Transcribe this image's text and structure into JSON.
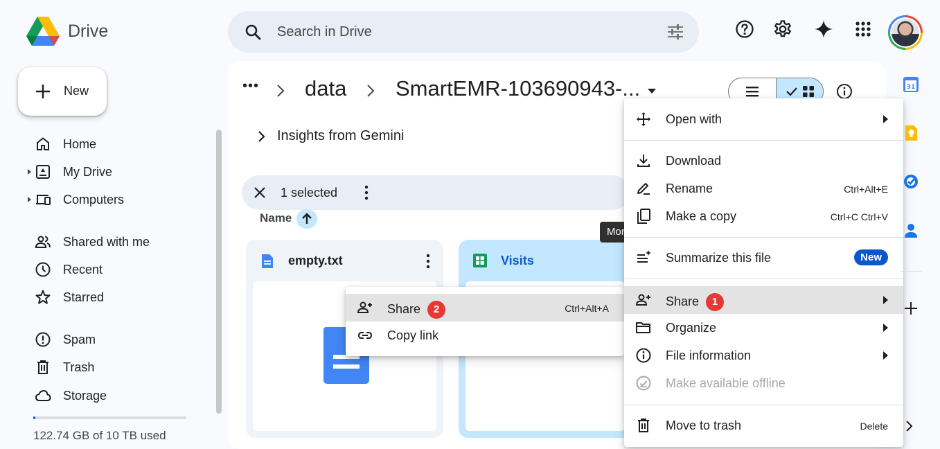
{
  "app": {
    "title": "Drive"
  },
  "search": {
    "placeholder": "Search in Drive"
  },
  "new_button": {
    "label": "New"
  },
  "sidebar": {
    "items": [
      {
        "label": "Home",
        "icon": "home-icon",
        "expandable": false
      },
      {
        "label": "My Drive",
        "icon": "my-drive-icon",
        "expandable": true
      },
      {
        "label": "Computers",
        "icon": "computers-icon",
        "expandable": true
      },
      {
        "label": "Shared with me",
        "icon": "shared-icon",
        "expandable": false
      },
      {
        "label": "Recent",
        "icon": "clock-icon",
        "expandable": false
      },
      {
        "label": "Starred",
        "icon": "star-icon",
        "expandable": false
      },
      {
        "label": "Spam",
        "icon": "spam-icon",
        "expandable": false
      },
      {
        "label": "Trash",
        "icon": "trash-icon",
        "expandable": false
      },
      {
        "label": "Storage",
        "icon": "cloud-icon",
        "expandable": false
      }
    ],
    "storage": {
      "text": "122.74 GB of 10 TB used",
      "fraction_used": 0.012
    }
  },
  "breadcrumb": {
    "ellipsis": "•••",
    "parent": "data",
    "current": "SmartEMR-103690943-..."
  },
  "insights": {
    "label": "Insights from Gemini"
  },
  "selection_bar": {
    "count_text": "1 selected"
  },
  "column_header": {
    "name": "Name"
  },
  "tooltip": {
    "text": "More"
  },
  "files": [
    {
      "name": "empty.txt",
      "type": "doc",
      "color": "#4285f4"
    },
    {
      "name": "Visits",
      "type": "sheet",
      "color": "#0f9d58"
    }
  ],
  "file_submenu": {
    "items": [
      {
        "label": "Share",
        "shortcut": "Ctrl+Alt+A",
        "step": "2",
        "icon": "person-add-icon"
      },
      {
        "label": "Copy link",
        "shortcut": "",
        "icon": "link-icon"
      }
    ]
  },
  "context_menu": {
    "items": [
      {
        "label": "Open with",
        "icon": "move-icon",
        "submenu": true
      },
      {
        "label": "Download",
        "icon": "download-icon"
      },
      {
        "label": "Rename",
        "icon": "rename-icon",
        "shortcut": "Ctrl+Alt+E"
      },
      {
        "label": "Make a copy",
        "icon": "copy-icon",
        "shortcut": "Ctrl+C Ctrl+V"
      },
      {
        "label": "Summarize this file",
        "icon": "summarize-icon",
        "badge": "New"
      },
      {
        "label": "Share",
        "icon": "person-add-icon",
        "submenu": true,
        "step": "1"
      },
      {
        "label": "Organize",
        "icon": "folder-icon",
        "submenu": true
      },
      {
        "label": "File information",
        "icon": "info-icon",
        "submenu": true
      },
      {
        "label": "Make available offline",
        "icon": "offline-icon",
        "disabled": true
      },
      {
        "label": "Move to trash",
        "icon": "trash-icon",
        "shortcut": "Delete"
      }
    ]
  },
  "colors": {
    "accent_blue": "#0b57d0",
    "selection_blue": "#c2e7ff",
    "step_badge_red": "#e53935",
    "search_bg": "#e9eef6"
  }
}
